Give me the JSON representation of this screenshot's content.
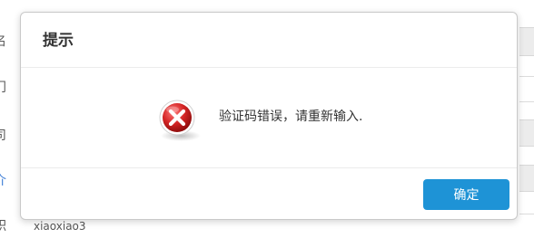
{
  "background": {
    "left_glyphs": [
      "名",
      "门",
      "司",
      "介",
      "职"
    ],
    "bottom_row_text": "xiaoxiao3"
  },
  "dialog": {
    "title": "提示",
    "message": "验证码错误，请重新输入.",
    "ok_label": "确定",
    "icon": "error-x-icon",
    "colors": {
      "button_bg": "#1e93d6",
      "icon_red": "#d42424"
    }
  }
}
